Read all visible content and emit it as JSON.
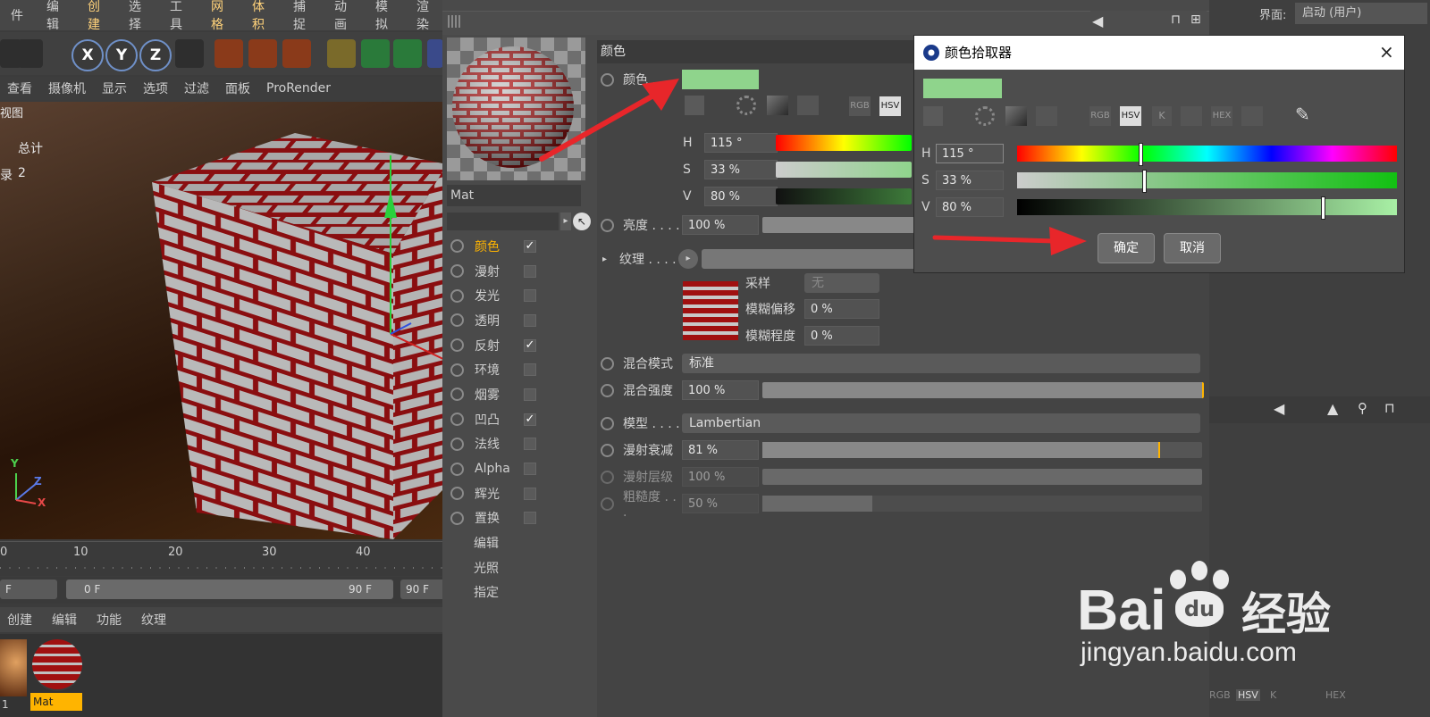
{
  "menubar": [
    "件",
    "编辑",
    "创建",
    "选择",
    "工具",
    "网格",
    "体积",
    "捕捉",
    "动画",
    "模拟",
    "渲染"
  ],
  "toolbar": {
    "axes": [
      "X",
      "Y",
      "Z"
    ]
  },
  "viewmenu": [
    "查看",
    "摄像机",
    "显示",
    "选项",
    "过滤",
    "面板",
    "ProRender"
  ],
  "viewport": {
    "label": "视图",
    "stat_title": "总计",
    "stat_row_label": "录",
    "stat_row_value": "2",
    "axis_y": "Y",
    "axis_z": "Z",
    "axis_x": "X"
  },
  "timeline": {
    "ticks": [
      "0",
      "10",
      "20",
      "30",
      "40"
    ]
  },
  "frames": {
    "start": "F",
    "range_start": "0 F",
    "range_end": "90 F",
    "end": "90 F"
  },
  "bottommenu": [
    "创建",
    "编辑",
    "功能",
    "纹理"
  ],
  "matbar": {
    "items": [
      "1",
      "Mat"
    ]
  },
  "material": {
    "name": "Mat",
    "channels": [
      {
        "label": "颜色",
        "checked": true,
        "active": true
      },
      {
        "label": "漫射",
        "checked": false
      },
      {
        "label": "发光",
        "checked": false
      },
      {
        "label": "透明",
        "checked": false
      },
      {
        "label": "反射",
        "checked": true
      },
      {
        "label": "环境",
        "checked": false
      },
      {
        "label": "烟雾",
        "checked": false
      },
      {
        "label": "凹凸",
        "checked": true
      },
      {
        "label": "法线",
        "checked": false
      },
      {
        "label": "Alpha",
        "checked": false
      },
      {
        "label": "辉光",
        "checked": false
      },
      {
        "label": "置换",
        "checked": false
      }
    ],
    "sections": [
      "编辑",
      "光照",
      "指定"
    ]
  },
  "attrs": {
    "header": "颜色",
    "color_label": "颜色 . .",
    "h_label": "H",
    "h_value": "115 °",
    "s_label": "S",
    "s_value": "33 %",
    "v_label": "V",
    "v_value": "80 %",
    "brightness_label": "亮度 . . . .",
    "brightness_value": "100 %",
    "texture_label": "纹理 . . . .",
    "sampling_label": "采样",
    "sampling_value": "无",
    "blur_offset_label": "模糊偏移",
    "blur_offset_value": "0 %",
    "blur_scale_label": "模糊程度",
    "blur_scale_value": "0 %",
    "mix_mode_label": "混合模式",
    "mix_mode_value": "标准",
    "mix_strength_label": "混合强度",
    "mix_strength_value": "100 %",
    "model_label": "模型 . . . .",
    "model_value": "Lambertian",
    "diffuse_falloff_label": "漫射衰减",
    "diffuse_falloff_value": "81 %",
    "diffuse_level_label": "漫射层级",
    "diffuse_level_value": "100 %",
    "roughness_label": "粗糙度 . . .",
    "roughness_value": "50 %",
    "mode_buttons": [
      "RGB",
      "HSV"
    ]
  },
  "picker": {
    "title": "颜色拾取器",
    "h_label": "H",
    "h_value": "115 °",
    "s_label": "S",
    "s_value": "33 %",
    "v_label": "V",
    "v_value": "80 %",
    "mode_buttons": [
      "RGB",
      "HSV",
      "K",
      "HEX"
    ],
    "ok": "确定",
    "cancel": "取消"
  },
  "rightpanel": {
    "interface_label": "界面:",
    "interface_value": "启动 (用户)",
    "mode_buttons": [
      "RGB",
      "HSV",
      "K",
      "HEX"
    ]
  },
  "watermark": {
    "brand": "Bai",
    "brand2": "du",
    "brand3": "经验",
    "url": "jingyan.baidu.com"
  },
  "colors": {
    "swatch": "#8fd48c",
    "accent": "#ffb400",
    "arrow": "#e8262a"
  }
}
